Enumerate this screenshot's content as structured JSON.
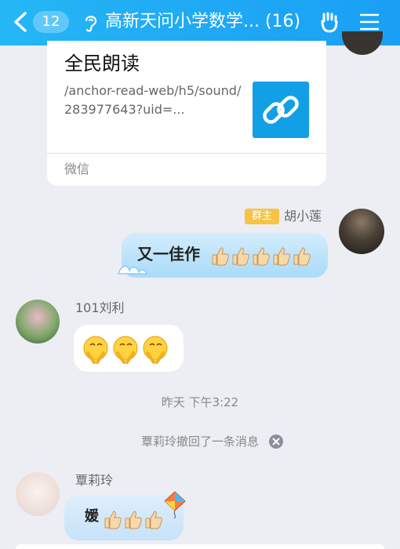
{
  "header": {
    "unread_count": "12",
    "title": "高新天问小学数学... (16)"
  },
  "link_card": {
    "title": "全民朗读",
    "url": "/anchor-read-web/h5/sound/283977643?uid=...",
    "source": "微信"
  },
  "messages": [
    {
      "sender": "胡小莲",
      "role_badge": "群主",
      "text": "又一佳作",
      "thumbs_up": 5
    },
    {
      "sender": "101刘利",
      "emoji_count": 3
    },
    {
      "timestamp": "昨天 下午3:22"
    },
    {
      "system_notice": "覃莉玲撤回了一条消息"
    },
    {
      "sender": "覃莉玲",
      "text": "媛",
      "thumbs_up": 3
    }
  ],
  "colors": {
    "header_blue": "#1fa8f5",
    "owner_badge": "#f6c343",
    "link_thumb": "#11a0e6"
  },
  "icons": [
    "back-icon",
    "ear-icon",
    "hand-icon",
    "menu-icon",
    "link-icon",
    "close-icon",
    "thumbs-up-icon",
    "kite-icon"
  ]
}
